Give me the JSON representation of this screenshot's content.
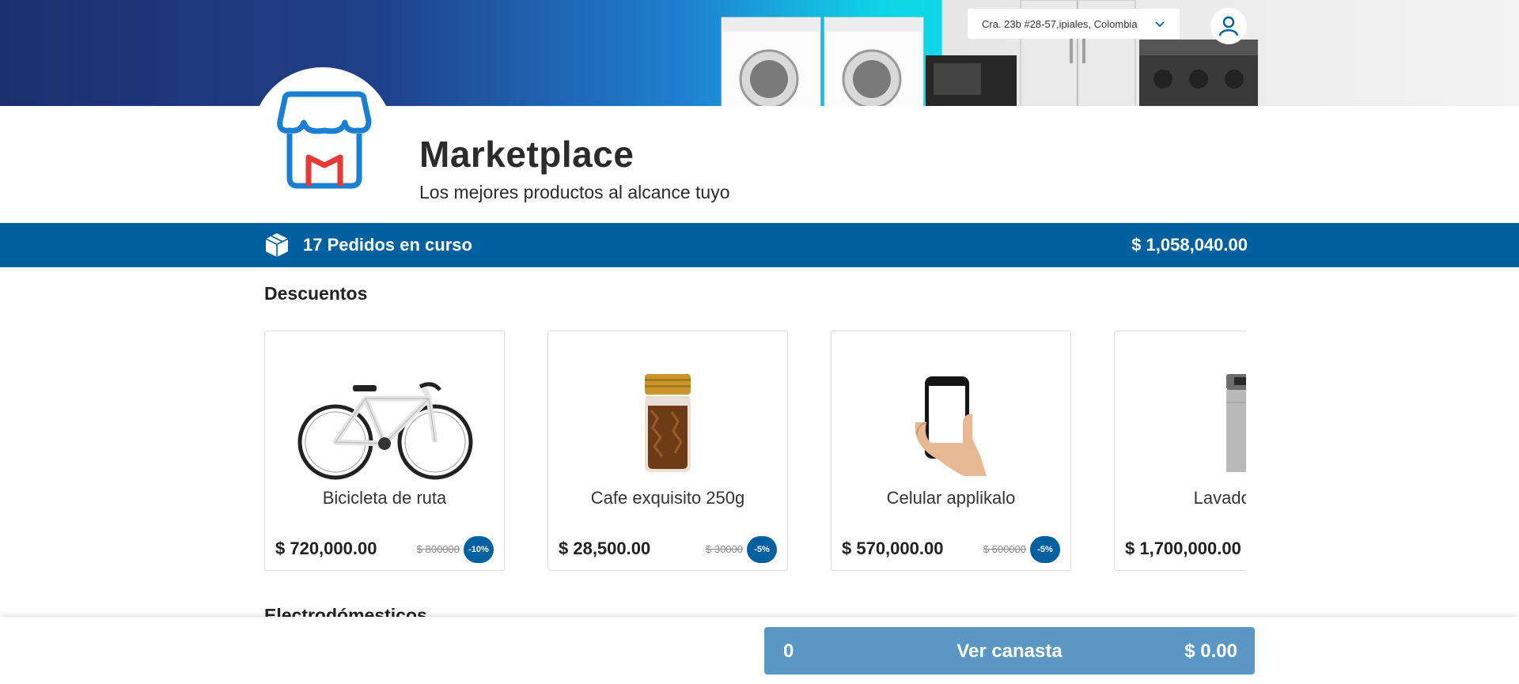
{
  "header": {
    "address": "Cra. 23b #28-57,ipiales, Colombia"
  },
  "store": {
    "title": "Marketplace",
    "subtitle": "Los mejores productos al alcance tuyo"
  },
  "orders": {
    "label": "17 Pedidos en curso",
    "total": "$ 1,058,040.00"
  },
  "sections": {
    "discounts": "Descuentos",
    "appliances": "Electrodómesticos"
  },
  "products": [
    {
      "name": "Bicicleta de ruta",
      "price": "$ 720,000.00",
      "old_price": "$ 800000",
      "discount": "-10%",
      "icon": "bicycle-image"
    },
    {
      "name": "Cafe exquisito 250g",
      "price": "$ 28,500.00",
      "old_price": "$ 30000",
      "discount": "-5%",
      "icon": "coffee-jar-image"
    },
    {
      "name": "Celular applikalo",
      "price": "$ 570,000.00",
      "old_price": "$ 600000",
      "discount": "-5%",
      "icon": "smartphone-image"
    },
    {
      "name": "Lavadora l",
      "price": "$ 1,700,000.00",
      "old_price": "",
      "discount": "",
      "icon": "washing-machine-image"
    }
  ],
  "basket": {
    "count": "0",
    "label": "Ver canasta",
    "total": "$ 0.00"
  },
  "colors": {
    "primary": "#0060a0",
    "basket_button": "#5b97c4",
    "logo_blue": "#1a7fd0",
    "logo_red": "#e53935"
  }
}
